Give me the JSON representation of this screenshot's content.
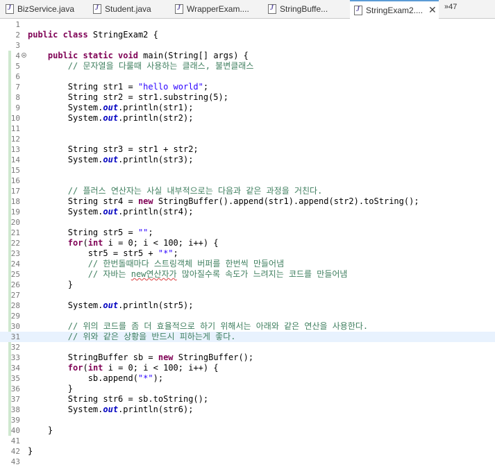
{
  "tabs": [
    {
      "label": "BizService.java",
      "active": false
    },
    {
      "label": "Student.java",
      "active": false
    },
    {
      "label": "WrapperExam....",
      "active": false
    },
    {
      "label": "StringBuffe...",
      "active": false
    },
    {
      "label": "StringExam2....",
      "active": true
    }
  ],
  "overflow_label": "»47",
  "highlighted_line": 31,
  "lines": [
    {
      "n": "1",
      "tokens": []
    },
    {
      "n": "2",
      "tokens": [
        {
          "t": "public class",
          "c": "kw"
        },
        {
          "t": " StringExam2 {",
          "c": ""
        }
      ]
    },
    {
      "n": "3",
      "tokens": []
    },
    {
      "n": "4",
      "marker": true,
      "tokens": [
        {
          "t": "    ",
          "c": ""
        },
        {
          "t": "public static void",
          "c": "kw"
        },
        {
          "t": " main(String[] args) {",
          "c": ""
        }
      ]
    },
    {
      "n": "5",
      "tokens": [
        {
          "t": "        ",
          "c": ""
        },
        {
          "t": "// 문자열을 다룰때 사용하는 클래스, 불변클래스",
          "c": "cm"
        }
      ]
    },
    {
      "n": "6",
      "tokens": []
    },
    {
      "n": "7",
      "tokens": [
        {
          "t": "        String str1 = ",
          "c": ""
        },
        {
          "t": "\"hello world\"",
          "c": "str"
        },
        {
          "t": ";",
          "c": ""
        }
      ]
    },
    {
      "n": "8",
      "tokens": [
        {
          "t": "        String str2 = str1.substring(5);",
          "c": ""
        }
      ]
    },
    {
      "n": "9",
      "tokens": [
        {
          "t": "        System.",
          "c": ""
        },
        {
          "t": "out",
          "c": "fld"
        },
        {
          "t": ".println(str1);",
          "c": ""
        }
      ]
    },
    {
      "n": "10",
      "tokens": [
        {
          "t": "        System.",
          "c": ""
        },
        {
          "t": "out",
          "c": "fld"
        },
        {
          "t": ".println(str2);",
          "c": ""
        }
      ]
    },
    {
      "n": "11",
      "tokens": []
    },
    {
      "n": "12",
      "tokens": []
    },
    {
      "n": "13",
      "tokens": [
        {
          "t": "        String str3 = str1 + str2;",
          "c": ""
        }
      ]
    },
    {
      "n": "14",
      "tokens": [
        {
          "t": "        System.",
          "c": ""
        },
        {
          "t": "out",
          "c": "fld"
        },
        {
          "t": ".println(str3);",
          "c": ""
        }
      ]
    },
    {
      "n": "15",
      "tokens": []
    },
    {
      "n": "16",
      "tokens": []
    },
    {
      "n": "17",
      "tokens": [
        {
          "t": "        ",
          "c": ""
        },
        {
          "t": "// 플러스 연산자는 사실 내부적으로는 다음과 같은 과정을 거친다.",
          "c": "cm"
        }
      ]
    },
    {
      "n": "18",
      "tokens": [
        {
          "t": "        String str4 = ",
          "c": ""
        },
        {
          "t": "new",
          "c": "kw"
        },
        {
          "t": " StringBuffer().append(str1).append(str2).toString();",
          "c": ""
        }
      ]
    },
    {
      "n": "19",
      "tokens": [
        {
          "t": "        System.",
          "c": ""
        },
        {
          "t": "out",
          "c": "fld"
        },
        {
          "t": ".println(str4);",
          "c": ""
        }
      ]
    },
    {
      "n": "20",
      "tokens": []
    },
    {
      "n": "21",
      "tokens": [
        {
          "t": "        String str5 = ",
          "c": ""
        },
        {
          "t": "\"\"",
          "c": "str"
        },
        {
          "t": ";",
          "c": ""
        }
      ]
    },
    {
      "n": "22",
      "tokens": [
        {
          "t": "        ",
          "c": ""
        },
        {
          "t": "for",
          "c": "kw"
        },
        {
          "t": "(",
          "c": ""
        },
        {
          "t": "int",
          "c": "kw"
        },
        {
          "t": " i = 0; i < 100; i++) {",
          "c": ""
        }
      ]
    },
    {
      "n": "23",
      "tokens": [
        {
          "t": "            str5 = str5 + ",
          "c": ""
        },
        {
          "t": "\"*\"",
          "c": "str"
        },
        {
          "t": ";",
          "c": ""
        }
      ]
    },
    {
      "n": "24",
      "tokens": [
        {
          "t": "            ",
          "c": ""
        },
        {
          "t": "// 한번돌때마다 스트링객체 버퍼를 한번씩 만들어냄",
          "c": "cm"
        }
      ]
    },
    {
      "n": "25",
      "tokens": [
        {
          "t": "            ",
          "c": ""
        },
        {
          "t": "// 자바는 ",
          "c": "cm"
        },
        {
          "t": "new연산자가",
          "c": "cm sq"
        },
        {
          "t": " 많아질수록 속도가 느려지는 코드를 만들어냄",
          "c": "cm"
        }
      ]
    },
    {
      "n": "26",
      "tokens": [
        {
          "t": "        }",
          "c": ""
        }
      ]
    },
    {
      "n": "27",
      "tokens": []
    },
    {
      "n": "28",
      "tokens": [
        {
          "t": "        System.",
          "c": ""
        },
        {
          "t": "out",
          "c": "fld"
        },
        {
          "t": ".println(str5);",
          "c": ""
        }
      ]
    },
    {
      "n": "29",
      "tokens": []
    },
    {
      "n": "30",
      "tokens": [
        {
          "t": "        ",
          "c": ""
        },
        {
          "t": "// 위의 코드를 좀 더 효율적으로 하기 위해서는 아래와 같은 연산을 사용한다.",
          "c": "cm"
        }
      ]
    },
    {
      "n": "31",
      "tokens": [
        {
          "t": "        ",
          "c": ""
        },
        {
          "t": "// 위와 같은 상황을 반드시 피하는게 좋다.",
          "c": "cm"
        }
      ]
    },
    {
      "n": "32",
      "tokens": []
    },
    {
      "n": "33",
      "tokens": [
        {
          "t": "        StringBuffer sb = ",
          "c": ""
        },
        {
          "t": "new",
          "c": "kw"
        },
        {
          "t": " StringBuffer();",
          "c": ""
        }
      ]
    },
    {
      "n": "34",
      "tokens": [
        {
          "t": "        ",
          "c": ""
        },
        {
          "t": "for",
          "c": "kw"
        },
        {
          "t": "(",
          "c": ""
        },
        {
          "t": "int",
          "c": "kw"
        },
        {
          "t": " i = 0; i < 100; i++) {",
          "c": ""
        }
      ]
    },
    {
      "n": "35",
      "tokens": [
        {
          "t": "            sb.append(",
          "c": ""
        },
        {
          "t": "\"*\"",
          "c": "str"
        },
        {
          "t": ");",
          "c": ""
        }
      ]
    },
    {
      "n": "36",
      "tokens": [
        {
          "t": "        }",
          "c": ""
        }
      ]
    },
    {
      "n": "37",
      "tokens": [
        {
          "t": "        String str6 = sb.toString();",
          "c": ""
        }
      ]
    },
    {
      "n": "38",
      "tokens": [
        {
          "t": "        System.",
          "c": ""
        },
        {
          "t": "out",
          "c": "fld"
        },
        {
          "t": ".println(str6);",
          "c": ""
        }
      ]
    },
    {
      "n": "39",
      "tokens": []
    },
    {
      "n": "40",
      "tokens": [
        {
          "t": "    }",
          "c": ""
        }
      ]
    },
    {
      "n": "41",
      "tokens": []
    },
    {
      "n": "42",
      "tokens": [
        {
          "t": "}",
          "c": ""
        }
      ]
    },
    {
      "n": "43",
      "tokens": []
    }
  ]
}
